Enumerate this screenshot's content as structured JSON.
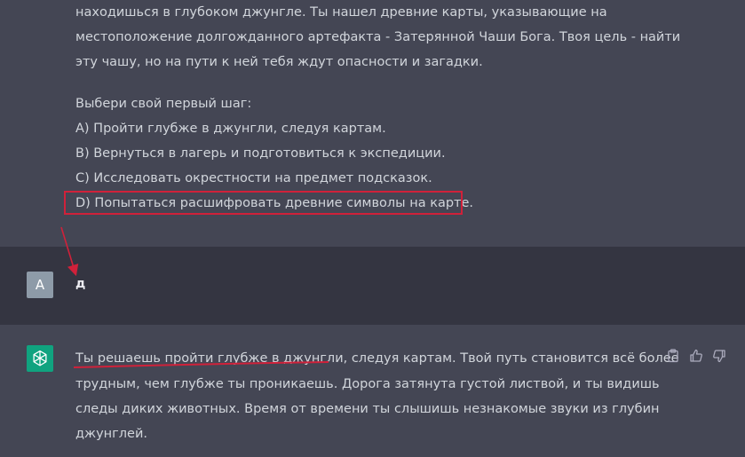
{
  "assistant_prev": {
    "lines": [
      "находишься в глубоком джунгле. Ты нашел древние карты, указывающие на",
      "местоположение долгожданного артефакта - Затерянной Чаши Бога. Твоя цель - найти",
      "эту чашу, но на пути к ней тебя ждут опасности и загадки."
    ],
    "prompt": "Выбери свой первый шаг:",
    "options": [
      "A) Пройти глубже в джунгли, следуя картам.",
      "B) Вернуться в лагерь и подготовиться к экспедиции.",
      "C) Исследовать окрестности на предмет подсказок.",
      "D) Попытаться расшифровать древние символы на карте."
    ]
  },
  "user_message": {
    "avatar_letter": "A",
    "text": "д"
  },
  "assistant_reply": {
    "lines": [
      "Ты решаешь пройти глубже в джунгли, следуя картам. Твой путь становится всё более",
      "трудным, чем глубже ты проникаешь. Дорога затянута густой листвой, и ты видишь",
      "следы диких животных. Время от времени ты слышишь незнакомые звуки из глубин",
      "джунглей."
    ]
  },
  "colors": {
    "assistant_bg": "#444654",
    "user_bg": "#343541",
    "gpt_green": "#10a37f",
    "annotation_red": "#d0213a"
  },
  "icons": [
    "openai-logo-icon",
    "clipboard-icon",
    "thumbs-up-icon",
    "thumbs-down-icon"
  ]
}
